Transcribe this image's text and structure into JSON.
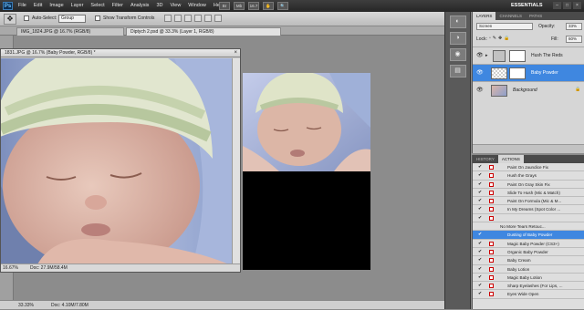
{
  "app": {
    "logo": "Ps",
    "menus": [
      "File",
      "Edit",
      "Image",
      "Layer",
      "Select",
      "Filter",
      "Analysis",
      "3D",
      "View",
      "Window",
      "Help"
    ],
    "zoom": "16.7",
    "workspace": "ESSENTIALS"
  },
  "options": {
    "auto_select": "Auto-Select:",
    "auto_select_value": "Group",
    "transform": "Show Transform Controls"
  },
  "tabs": [
    "IMG_1824.JPG @ 16.7% (RGB/8)",
    "Diptych 2.psd @ 33.3% (Layer 1, RGB/8)"
  ],
  "doc": {
    "title": "1831.JPG @ 16.7% (Baby Powder, RGB/8) *",
    "zoom": "16.67%",
    "size": "Doc: 27.9M/58.4M"
  },
  "status": {
    "zoom": "33.33%",
    "size": "Doc: 4.10M/7.80M"
  },
  "layers": {
    "tabs": [
      "LAYERS",
      "CHANNELS",
      "PATHS"
    ],
    "blend": "Screen",
    "opacity_label": "Opacity:",
    "opacity": "33%",
    "lock_label": "Lock:",
    "fill_label": "Fill:",
    "fill": "60%",
    "items": [
      {
        "name": "Hush The Reds",
        "selected": false
      },
      {
        "name": "Baby Powder",
        "selected": true
      },
      {
        "name": "Background",
        "selected": false
      }
    ]
  },
  "actions": {
    "tabs": [
      "HISTORY",
      "ACTIONS"
    ],
    "items": [
      "Paint On Jaundice Fix",
      "Hush the Grays",
      "Paint On Gray Skin Fix",
      "Slide To Hush (Mic & Match)",
      "Paint On Formula (Mic & M...",
      "In My Dreams (Spot Color ...",
      "",
      "No More Tears Retouc...",
      "Dusting of Baby Powder",
      "Magic Baby Powder (CS3+)",
      "Organic Baby Powder",
      "Baby Cream",
      "Baby Lotion",
      "Magic Baby Lotion",
      "Sharp Eyelashes (For Lips, ...",
      "Eyes Wide Open"
    ],
    "highlight": 8
  }
}
